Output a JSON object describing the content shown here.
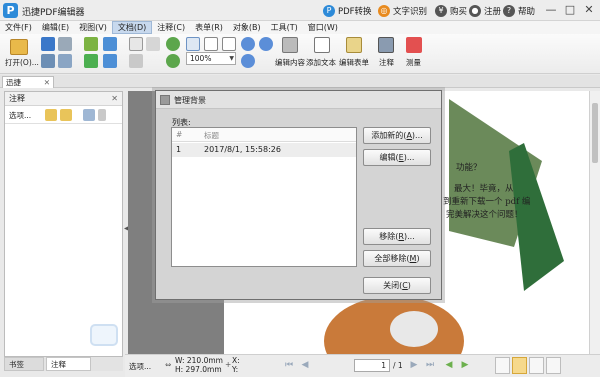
{
  "app": {
    "logo": "P",
    "title": "迅捷PDF编辑器"
  },
  "titlebar_actions": [
    {
      "label": "PDF转换",
      "icon": "pdf-convert-icon",
      "color": "#2d8ad8"
    },
    {
      "label": "文字识别",
      "icon": "ocr-icon",
      "color": "#e88a1e"
    },
    {
      "label": "购买",
      "icon": "cart-icon",
      "color": "#555555"
    },
    {
      "label": "注册",
      "icon": "user-icon",
      "color": "#555555"
    },
    {
      "label": "帮助",
      "icon": "help-icon",
      "color": "#555555"
    }
  ],
  "window_controls": {
    "minimize": "—",
    "maximize": "□",
    "close": "✕"
  },
  "menu": [
    "文件(F)",
    "编辑(E)",
    "视图(V)",
    "文档(D)",
    "注释(C)",
    "表单(R)",
    "对象(B)",
    "工具(T)",
    "窗口(W)"
  ],
  "menu_active_index": 3,
  "ribbon": {
    "open_label": "打开(O)...",
    "zoom_value": "100%",
    "edit_content": "编辑内容",
    "add_text": "添加文本",
    "edit_form": "编辑表单",
    "annotate": "注释",
    "measure": "测量"
  },
  "doc_tab": {
    "label": "迅捷",
    "close": "✕"
  },
  "left_panel": {
    "title": "注释",
    "close": "✕",
    "options": "选项...",
    "tabs": [
      "书签",
      "注释"
    ]
  },
  "document_text": {
    "line1": "功能？",
    "line2": "最大！毕竟，从",
    "line3": "到重新下载一个 pdf 编",
    "line4": "完美解决这个问题！"
  },
  "dialog": {
    "title": "管理背景",
    "list_label": "列表:",
    "columns": [
      "#",
      "标题"
    ],
    "rows": [
      {
        "num": "1",
        "title": "2017/8/1, 15:58:26"
      }
    ],
    "buttons": {
      "add_new": {
        "text": "添加新的(",
        "key": "A",
        "suffix": ")..."
      },
      "edit": {
        "text": "编辑(",
        "key": "E",
        "suffix": ")..."
      },
      "remove": {
        "text": "移除(",
        "key": "R",
        "suffix": ")..."
      },
      "remove_all": {
        "text": "全部移除(",
        "key": "M",
        "suffix": ")"
      },
      "close": {
        "text": "关闭(",
        "key": "C",
        "suffix": ")"
      }
    }
  },
  "statusbar": {
    "options": "选项...",
    "w": "W: 210.0mm",
    "h": "H: 297.0mm",
    "x": "X:",
    "y": "Y:",
    "page_current": "1",
    "page_total": "/ 1"
  }
}
